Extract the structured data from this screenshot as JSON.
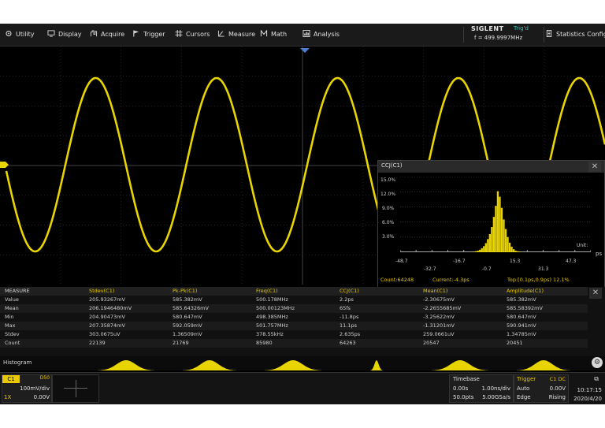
{
  "menu": {
    "items": [
      {
        "label": "Utility",
        "icon": "utility-icon"
      },
      {
        "label": "Display",
        "icon": "display-icon"
      },
      {
        "label": "Acquire",
        "icon": "acquire-icon"
      },
      {
        "label": "Trigger",
        "icon": "trigger-flag-icon"
      },
      {
        "label": "Cursors",
        "icon": "cursors-icon"
      },
      {
        "label": "Measure",
        "icon": "measure-icon"
      },
      {
        "label": "Math",
        "icon": "math-icon"
      },
      {
        "label": "Analysis",
        "icon": "analysis-icon"
      }
    ],
    "brand": "SIGLENT",
    "trigger_state": "Trig'd",
    "frequency": "f = 499.9997MHz",
    "statistics_config": "Statistics Config"
  },
  "histogram_window": {
    "title": "CCJ(C1)",
    "y_ticks": [
      "15.0%",
      "12.0%",
      "9.0%",
      "6.0%",
      "3.0%"
    ],
    "x_ticks_upper": [
      "-48.7",
      "-16.7",
      "15.3",
      "47.3"
    ],
    "x_ticks_lower": [
      "-32.7",
      "-0.7",
      "31.3"
    ],
    "unit_label": "Unit:",
    "unit": "ps",
    "count": "Count:64248",
    "current": "Current:-4.3ps",
    "top": "Top:[0.1ps,0.9ps) 12.1%",
    "chart_data": {
      "type": "bar",
      "ylim": [
        0,
        15
      ],
      "xlim": [
        -48.7,
        47.3
      ],
      "bins_x": [
        -12,
        -11,
        -10,
        -9,
        -8,
        -7,
        -6,
        -5,
        -4,
        -3,
        -2,
        -1,
        0,
        1,
        2,
        3,
        4,
        5,
        6,
        7,
        8,
        9,
        10,
        11
      ],
      "bins_y": [
        0.1,
        0.2,
        0.3,
        0.5,
        0.8,
        1.2,
        1.8,
        2.6,
        3.6,
        5.0,
        7.0,
        9.2,
        12.1,
        11.0,
        8.8,
        6.5,
        4.6,
        3.0,
        1.9,
        1.1,
        0.6,
        0.3,
        0.2,
        0.1
      ]
    }
  },
  "measure": {
    "header_label": "MEASURE",
    "columns": [
      "Stdev(C1)",
      "Pk-Pk(C1)",
      "Freq(C1)",
      "CCJ(C1)",
      "Mean(C1)",
      "Amplitude(C1)"
    ],
    "rows": [
      {
        "label": "Value",
        "cells": [
          "205.93267mV",
          "585.382mV",
          "500.178MHz",
          "2.2ps",
          "-2.30675mV",
          "585.382mV"
        ]
      },
      {
        "label": "Mean",
        "cells": [
          "206.1946480mV",
          "585.64326mV",
          "500.00123MHz",
          "65fs",
          "-2.2655685mV",
          "585.58392mV"
        ]
      },
      {
        "label": "Min",
        "cells": [
          "204.90473mV",
          "580.647mV",
          "498.385MHz",
          "-11.8ps",
          "-3.25622mV",
          "580.647mV"
        ]
      },
      {
        "label": "Max",
        "cells": [
          "207.35874mV",
          "592.059mV",
          "501.757MHz",
          "11.1ps",
          "-1.31201mV",
          "590.941mV"
        ]
      },
      {
        "label": "Stdev",
        "cells": [
          "303.0675uV",
          "1.36509mV",
          "378.55kHz",
          "2.635ps",
          "259.0661uV",
          "1.34785mV"
        ]
      },
      {
        "label": "Count",
        "cells": [
          "22139",
          "21769",
          "85980",
          "64263",
          "20547",
          "20451"
        ]
      }
    ]
  },
  "histogram_strip": {
    "label": "Histogram"
  },
  "channel": {
    "name": "C1",
    "bw": "D50",
    "scale": "100mV/div",
    "probe": "1X",
    "offset": "0.00V"
  },
  "timebase": {
    "title": "Timebase",
    "delay": "0.00s",
    "scale": "1.00ns/div",
    "points": "50.0pts",
    "rate": "5.00GSa/s"
  },
  "trigger": {
    "title": "Trigger",
    "source": "C1 DC",
    "mode": "Auto",
    "level": "0.00V",
    "type": "Edge",
    "slope": "Rising"
  },
  "clock": {
    "time": "10:17:15",
    "date": "2020/4/20"
  },
  "colors": {
    "trace": "#e8d400",
    "accent_teal": "#3cc3b5",
    "marker_blue": "#4a7fd4"
  }
}
